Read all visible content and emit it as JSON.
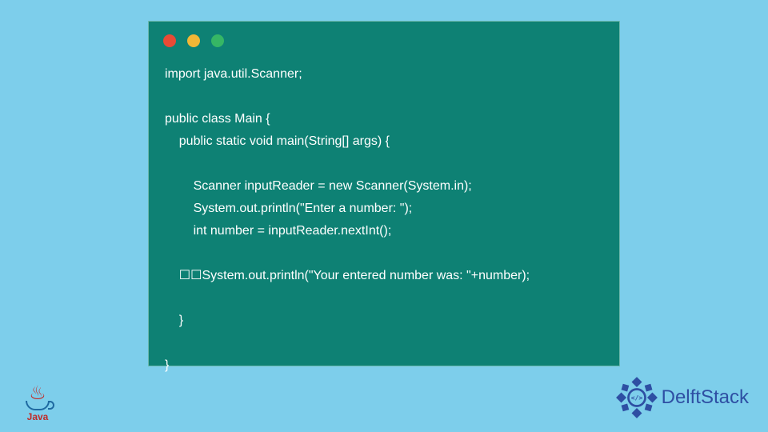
{
  "code": {
    "lines": [
      "import java.util.Scanner;",
      "",
      "public class Main {",
      "    public static void main(String[] args) {",
      "",
      "        Scanner inputReader = new Scanner(System.in);",
      "        System.out.println(\"Enter a number: \");",
      "        int number = inputReader.nextInt();",
      "",
      "    ☐☐System.out.println(\"Your entered number was: \"+number);",
      "",
      "    }",
      "",
      "}"
    ]
  },
  "logos": {
    "java_label": "Java",
    "delft_label": "DelftStack"
  }
}
